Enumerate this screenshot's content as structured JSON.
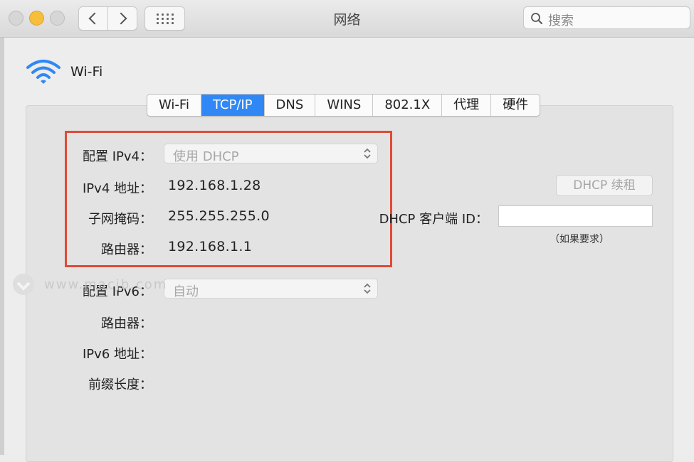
{
  "window": {
    "title": "网络"
  },
  "search": {
    "placeholder": "搜索"
  },
  "service": {
    "name": "Wi-Fi"
  },
  "tabs": [
    {
      "label": "Wi-Fi",
      "active": false
    },
    {
      "label": "TCP/IP",
      "active": true
    },
    {
      "label": "DNS",
      "active": false
    },
    {
      "label": "WINS",
      "active": false
    },
    {
      "label": "802.1X",
      "active": false
    },
    {
      "label": "代理",
      "active": false
    },
    {
      "label": "硬件",
      "active": false
    }
  ],
  "ipv4": {
    "config_label": "配置 IPv4：",
    "config_value": "使用 DHCP",
    "address_label": "IPv4 地址：",
    "address_value": "192.168.1.28",
    "subnet_label": "子网掩码：",
    "subnet_value": "255.255.255.0",
    "router_label": "路由器：",
    "router_value": "192.168.1.1"
  },
  "dhcp": {
    "renew_label": "DHCP 续租",
    "client_id_label": "DHCP 客户端 ID：",
    "client_id_value": "",
    "client_id_hint": "（如果要求）"
  },
  "ipv6": {
    "config_label": "配置 IPv6：",
    "config_value": "自动",
    "router_label": "路由器：",
    "address_label": "IPv6 地址：",
    "prefix_label": "前缀长度："
  },
  "watermark": {
    "text": "www.macjb.com"
  },
  "colors": {
    "accent": "#2f88f6",
    "highlight": "#df4b37"
  }
}
